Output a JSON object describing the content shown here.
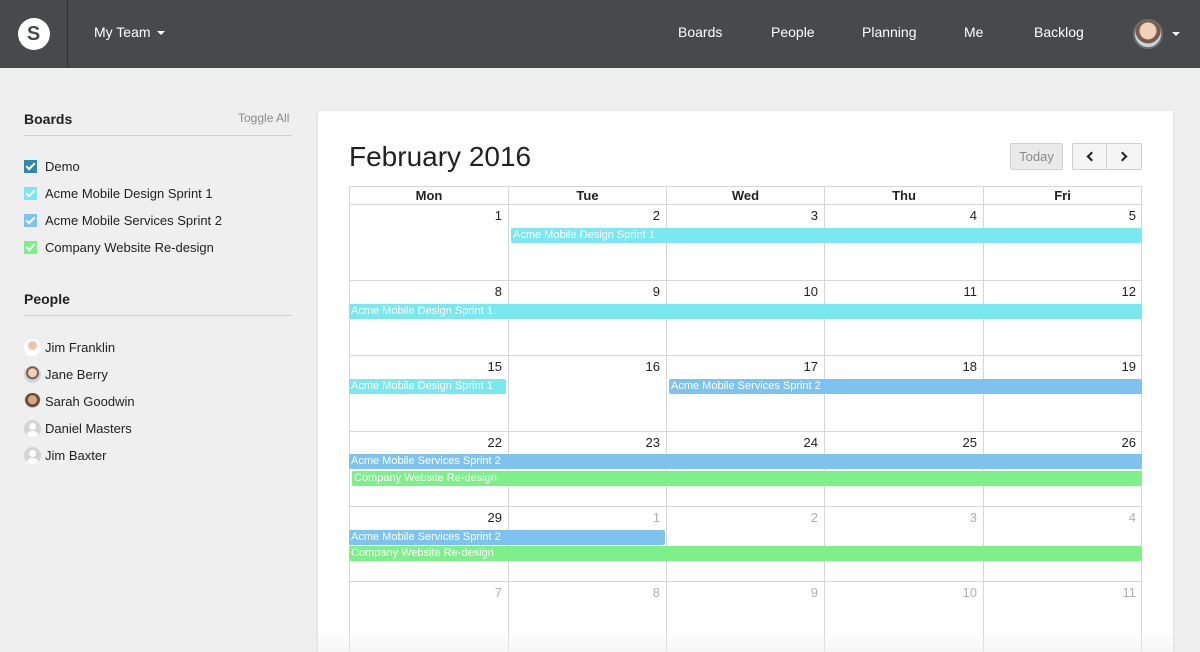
{
  "header": {
    "logo_letter": "S",
    "team_menu": "My Team",
    "nav": [
      "Boards",
      "People",
      "Planning",
      "Me",
      "Backlog"
    ]
  },
  "sidebar": {
    "boards_title": "Boards",
    "toggle_all": "Toggle All",
    "boards": [
      {
        "label": "Demo",
        "color": "#2e8aa8"
      },
      {
        "label": "Acme Mobile Design Sprint 1",
        "color": "#7ae8ef"
      },
      {
        "label": "Acme Mobile Services Sprint 2",
        "color": "#7ec3f0"
      },
      {
        "label": "Company Website Re-design",
        "color": "#7ef08a"
      }
    ],
    "people_title": "People",
    "people": [
      {
        "name": "Jim Franklin"
      },
      {
        "name": "Jane Berry"
      },
      {
        "name": "Sarah Goodwin"
      },
      {
        "name": "Daniel Masters"
      },
      {
        "name": "Jim Baxter"
      }
    ]
  },
  "calendar": {
    "title": "February 2016",
    "today_label": "Today",
    "weekdays": [
      "Mon",
      "Tue",
      "Wed",
      "Thu",
      "Fri"
    ],
    "weeks": [
      [
        "1",
        "2",
        "3",
        "4",
        "5"
      ],
      [
        "8",
        "9",
        "10",
        "11",
        "12"
      ],
      [
        "15",
        "16",
        "17",
        "18",
        "19"
      ],
      [
        "22",
        "23",
        "24",
        "25",
        "26"
      ],
      [
        "29",
        "1",
        "2",
        "3",
        "4"
      ],
      [
        "7",
        "8",
        "9",
        "10",
        "11"
      ]
    ],
    "events": {
      "design": "Acme Mobile Design Sprint 1",
      "services": "Acme Mobile Services Sprint 2",
      "website": "Company Website Re-design"
    }
  }
}
